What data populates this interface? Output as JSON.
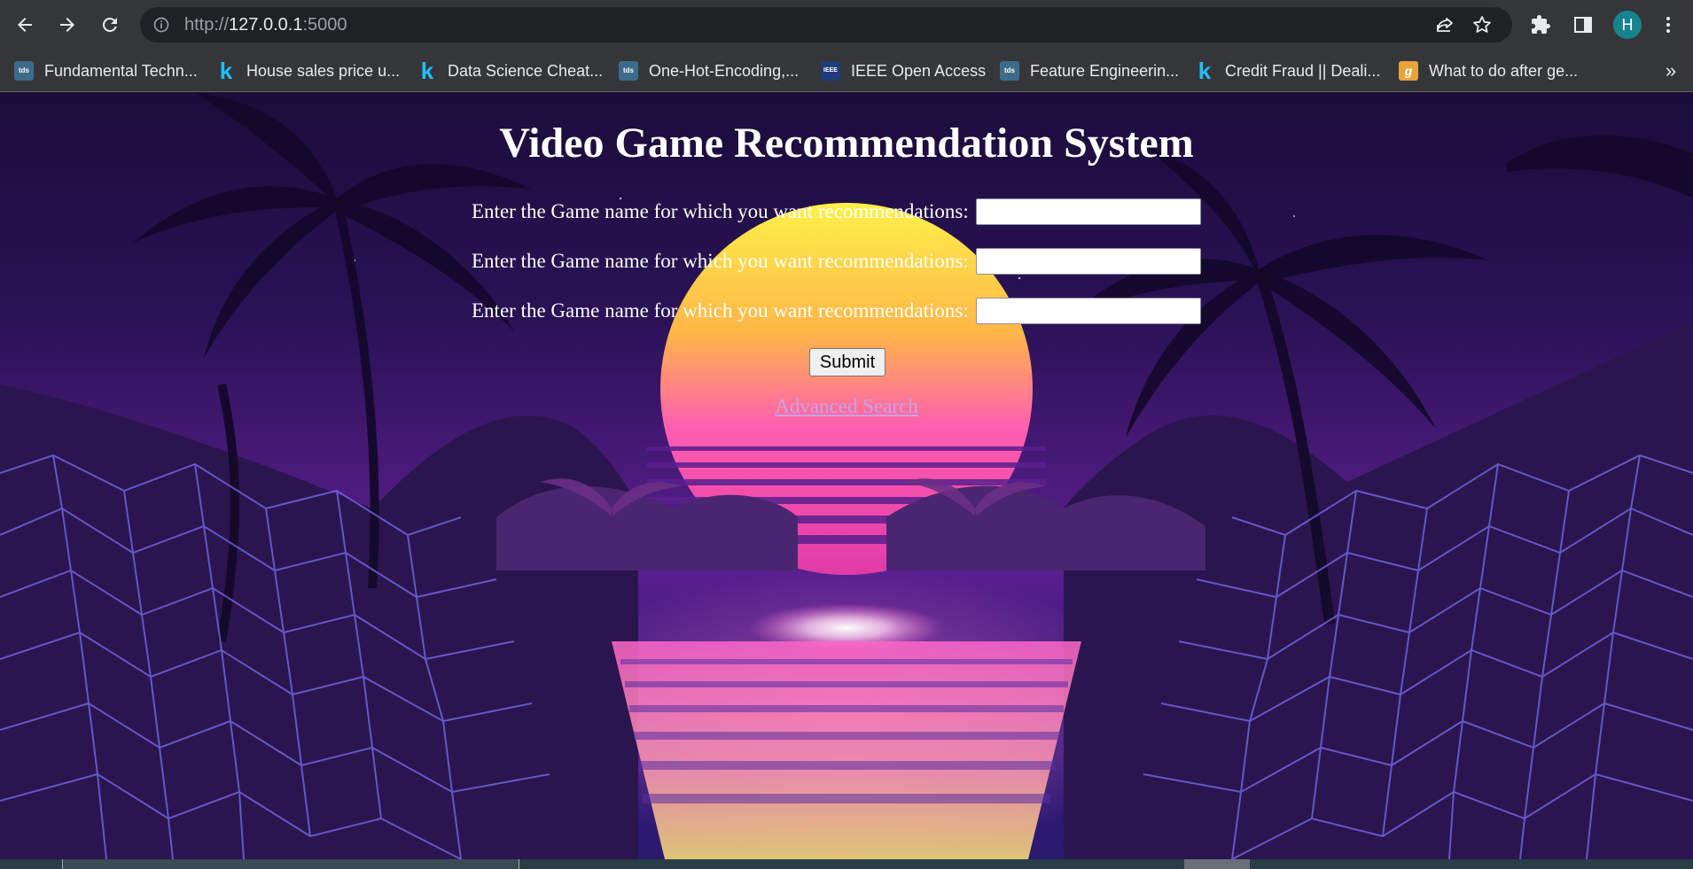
{
  "browser": {
    "url_prefix": "http://",
    "url_host": "127.0.0.1",
    "url_port": ":5000",
    "avatar_letter": "H",
    "bookmarks": [
      {
        "label": "Fundamental Techn...",
        "icon": "tds"
      },
      {
        "label": "House sales price u...",
        "icon": "k"
      },
      {
        "label": "Data Science Cheat...",
        "icon": "k"
      },
      {
        "label": "One-Hot-Encoding,...",
        "icon": "tds"
      },
      {
        "label": "IEEE Open Access",
        "icon": "IEEE"
      },
      {
        "label": "Feature Engineerin...",
        "icon": "tds"
      },
      {
        "label": "Credit Fraud || Deali...",
        "icon": "k"
      },
      {
        "label": "What to do after ge...",
        "icon": "g"
      }
    ],
    "more_label": "»"
  },
  "page": {
    "title": "Video Game Recommendation System",
    "fields": [
      {
        "label": "Enter the Game name for which you want recommendations:",
        "value": ""
      },
      {
        "label": "Enter the Game name for which you want recommendations:",
        "value": ""
      },
      {
        "label": "Enter the Game name for which you want recommendations:",
        "value": ""
      }
    ],
    "submit_label": "Submit",
    "advanced_link": "Advanced Search"
  },
  "colors": {
    "chrome_bg": "#35363a",
    "omnibox_bg": "#202124",
    "avatar": "#17838f",
    "link": "#c8a2e8",
    "sun_top": "#ffe94a",
    "sun_bottom": "#ff3fb0"
  }
}
